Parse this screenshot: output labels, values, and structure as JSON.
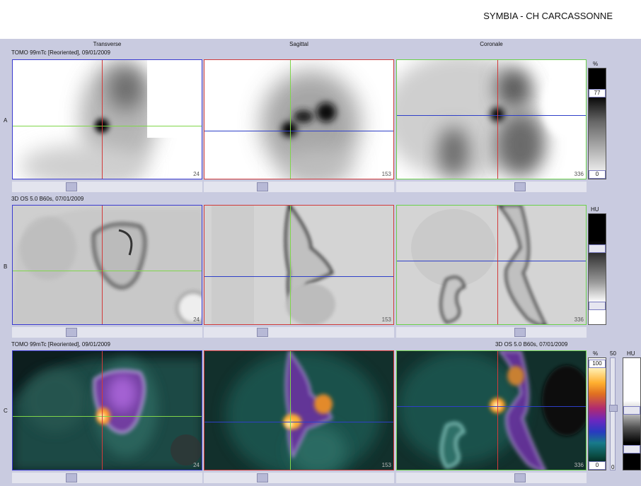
{
  "header": {
    "title": "SYMBIA - CH CARCASSONNE"
  },
  "columns": [
    "Transverse",
    "Sagittal",
    "Coronale"
  ],
  "rows": {
    "A": {
      "label": "A",
      "series": "TOMO 99mTc [Reoriented], 09/01/2009",
      "unit": "%",
      "max": "77",
      "min": "0"
    },
    "B": {
      "label": "B",
      "series": "3D  OS  5.0  B60s, 07/01/2009",
      "unit": "HU"
    },
    "C": {
      "label": "C",
      "series_left": "TOMO 99mTc [Reoriented], 09/01/2009",
      "series_right": "3D  OS  5.0  B60s, 07/01/2009",
      "unit_nm": "%",
      "max": "100",
      "min": "0",
      "slider_value": "50",
      "unit_ct": "HU",
      "ct_min": "0"
    }
  },
  "slices": {
    "transverse": "24",
    "sagittal": "153",
    "coronale": "336"
  },
  "colors": {
    "transverse_border": "#3a3ad0",
    "sagittal_border": "#d03a3a",
    "coronale_border": "#6ad04a",
    "cursor_red": "#d23b3b",
    "cursor_green": "#7fd64a",
    "cursor_blue": "#2e3fc8"
  },
  "icons": {
    "slider": "slider-thumb",
    "colorbar": "grayscale-bar"
  }
}
